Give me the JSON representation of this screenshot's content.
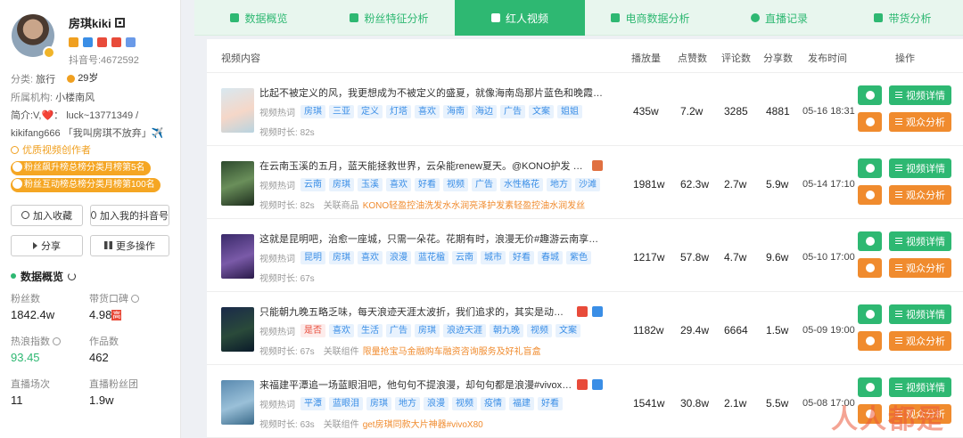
{
  "profile": {
    "name": "房琪kiki",
    "douyin_id": "抖音号:4672592",
    "category_label": "分类:",
    "category": "旅行",
    "age": "29岁",
    "agency_label": "所属机构:",
    "agency": "小楼南风",
    "bio_line1": "简介:V,❤️： luck~13771349 /",
    "bio_line2": "kikifang666 「我叫房琪不放弃」✈️",
    "creator_label": "优质视频创作者",
    "ranks": [
      "粉丝飙升榜总榜分类月榜第5名",
      "粉丝互动榜总榜分类月榜第100名"
    ]
  },
  "actions": {
    "favorite": "加入收藏",
    "add_douyin": "加入我的抖音号",
    "share": "分享",
    "more": "更多操作"
  },
  "overview": {
    "title": "数据概览",
    "fans_label": "粉丝数",
    "fans": "1842.4w",
    "reputation_label": "带货口碑",
    "reputation": "4.98",
    "reputation_badge": "高",
    "heat_label": "热浪指数",
    "heat": "93.45",
    "works_label": "作品数",
    "works": "462",
    "live_label": "直播场次",
    "live": "11",
    "live_fans_label": "直播粉丝团",
    "live_fans": "1.9w"
  },
  "tabs": [
    {
      "label": "数据概览"
    },
    {
      "label": "粉丝特征分析"
    },
    {
      "label": "红人视频"
    },
    {
      "label": "电商数据分析"
    },
    {
      "label": "直播记录"
    },
    {
      "label": "带货分析"
    }
  ],
  "table": {
    "headers": {
      "content": "视频内容",
      "plays": "播放量",
      "likes": "点赞数",
      "comments": "评论数",
      "shares": "分享数",
      "time": "发布时间",
      "ops": "操作"
    },
    "tag_label": "视频热词",
    "duration_label": "视频时长:",
    "product_label": "关联商品",
    "component_label": "关联组件",
    "detail_btn": "视频详情",
    "audience_btn": "观众分析",
    "rows": [
      {
        "title": "比起不被定义的风，我更想成为不被定义的盛夏，就像海南岛那片蓝色和晚霞……#vivo...",
        "tags": [
          "房琪",
          "三亚",
          "定义",
          "灯塔",
          "喜欢",
          "海南",
          "海边",
          "广告",
          "文案",
          "姐姐"
        ],
        "duration": "82s",
        "plays": "435w",
        "likes": "7.2w",
        "comments": "3285",
        "shares": "4881",
        "time": "05-16 18:31"
      },
      {
        "title": "在云南玉溪的五月，蓝天能拯救世界，云朵能renew夏天。@KONO护发 @KONO精选 #...",
        "tags": [
          "云南",
          "房琪",
          "玉溪",
          "喜欢",
          "好看",
          "视频",
          "广告",
          "水性格花",
          "地方",
          "沙滩"
        ],
        "duration": "82s",
        "product": "KONO轻盈控油洗发水水润亮泽护发素轻盈控油水润发丝",
        "plays": "1981w",
        "likes": "62.3w",
        "comments": "2.7w",
        "shares": "5.9w",
        "time": "05-14 17:10"
      },
      {
        "title": "这就是昆明吧，治愈一座城，只需一朵花。花期有时，浪漫无价#趣游云南享好礼",
        "tags": [
          "昆明",
          "房琪",
          "喜欢",
          "浪漫",
          "蓝花楹",
          "云南",
          "城市",
          "好看",
          "春城",
          "紫色"
        ],
        "duration": "67s",
        "plays": "1217w",
        "likes": "57.8w",
        "comments": "4.7w",
        "shares": "9.6w",
        "time": "05-10 17:00"
      },
      {
        "title": "只能朝九晚五略乏味，每天浪迹天涯太波折，我们追求的，其实是动态平衡的生...",
        "tags": [
          "是否",
          "喜欢",
          "生活",
          "广告",
          "房琪",
          "浪迹天涯",
          "朝九晚",
          "视频",
          "文案"
        ],
        "red_tag": 0,
        "duration": "67s",
        "component": "限量抢宝马金融购车融资咨询服务及好礼盲盒",
        "plays": "1182w",
        "likes": "29.4w",
        "comments": "6664",
        "shares": "1.5w",
        "time": "05-09 19:00"
      },
      {
        "title": "来福建平潭追一场蓝眼泪吧，他句句不提浪漫，却句句都是浪漫#vivox80 #抖in...",
        "tags": [
          "平潭",
          "蓝眼泪",
          "房琪",
          "地方",
          "浪漫",
          "视频",
          "疫情",
          "福建",
          "好看"
        ],
        "duration": "63s",
        "component": "get房琪同款大片神器#vivoX80",
        "plays": "1541w",
        "likes": "30.8w",
        "comments": "2.1w",
        "shares": "5.5w",
        "time": "05-08 17:00"
      }
    ]
  },
  "colors": {
    "primary": "#2eb872",
    "orange": "#f08b2e",
    "tag": "#3a8ee6"
  },
  "watermark": "人人都是"
}
